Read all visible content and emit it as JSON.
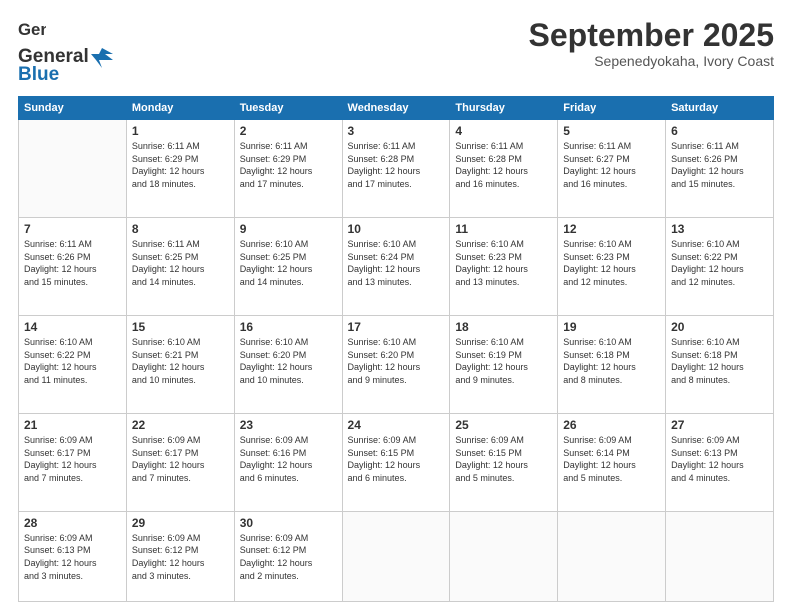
{
  "header": {
    "logo_line1": "General",
    "logo_line2": "Blue",
    "month": "September 2025",
    "location": "Sepenedyokaha, Ivory Coast"
  },
  "days_of_week": [
    "Sunday",
    "Monday",
    "Tuesday",
    "Wednesday",
    "Thursday",
    "Friday",
    "Saturday"
  ],
  "weeks": [
    [
      {
        "day": "",
        "info": ""
      },
      {
        "day": "1",
        "info": "Sunrise: 6:11 AM\nSunset: 6:29 PM\nDaylight: 12 hours\nand 18 minutes."
      },
      {
        "day": "2",
        "info": "Sunrise: 6:11 AM\nSunset: 6:29 PM\nDaylight: 12 hours\nand 17 minutes."
      },
      {
        "day": "3",
        "info": "Sunrise: 6:11 AM\nSunset: 6:28 PM\nDaylight: 12 hours\nand 17 minutes."
      },
      {
        "day": "4",
        "info": "Sunrise: 6:11 AM\nSunset: 6:28 PM\nDaylight: 12 hours\nand 16 minutes."
      },
      {
        "day": "5",
        "info": "Sunrise: 6:11 AM\nSunset: 6:27 PM\nDaylight: 12 hours\nand 16 minutes."
      },
      {
        "day": "6",
        "info": "Sunrise: 6:11 AM\nSunset: 6:26 PM\nDaylight: 12 hours\nand 15 minutes."
      }
    ],
    [
      {
        "day": "7",
        "info": "Sunrise: 6:11 AM\nSunset: 6:26 PM\nDaylight: 12 hours\nand 15 minutes."
      },
      {
        "day": "8",
        "info": "Sunrise: 6:11 AM\nSunset: 6:25 PM\nDaylight: 12 hours\nand 14 minutes."
      },
      {
        "day": "9",
        "info": "Sunrise: 6:10 AM\nSunset: 6:25 PM\nDaylight: 12 hours\nand 14 minutes."
      },
      {
        "day": "10",
        "info": "Sunrise: 6:10 AM\nSunset: 6:24 PM\nDaylight: 12 hours\nand 13 minutes."
      },
      {
        "day": "11",
        "info": "Sunrise: 6:10 AM\nSunset: 6:23 PM\nDaylight: 12 hours\nand 13 minutes."
      },
      {
        "day": "12",
        "info": "Sunrise: 6:10 AM\nSunset: 6:23 PM\nDaylight: 12 hours\nand 12 minutes."
      },
      {
        "day": "13",
        "info": "Sunrise: 6:10 AM\nSunset: 6:22 PM\nDaylight: 12 hours\nand 12 minutes."
      }
    ],
    [
      {
        "day": "14",
        "info": "Sunrise: 6:10 AM\nSunset: 6:22 PM\nDaylight: 12 hours\nand 11 minutes."
      },
      {
        "day": "15",
        "info": "Sunrise: 6:10 AM\nSunset: 6:21 PM\nDaylight: 12 hours\nand 10 minutes."
      },
      {
        "day": "16",
        "info": "Sunrise: 6:10 AM\nSunset: 6:20 PM\nDaylight: 12 hours\nand 10 minutes."
      },
      {
        "day": "17",
        "info": "Sunrise: 6:10 AM\nSunset: 6:20 PM\nDaylight: 12 hours\nand 9 minutes."
      },
      {
        "day": "18",
        "info": "Sunrise: 6:10 AM\nSunset: 6:19 PM\nDaylight: 12 hours\nand 9 minutes."
      },
      {
        "day": "19",
        "info": "Sunrise: 6:10 AM\nSunset: 6:18 PM\nDaylight: 12 hours\nand 8 minutes."
      },
      {
        "day": "20",
        "info": "Sunrise: 6:10 AM\nSunset: 6:18 PM\nDaylight: 12 hours\nand 8 minutes."
      }
    ],
    [
      {
        "day": "21",
        "info": "Sunrise: 6:09 AM\nSunset: 6:17 PM\nDaylight: 12 hours\nand 7 minutes."
      },
      {
        "day": "22",
        "info": "Sunrise: 6:09 AM\nSunset: 6:17 PM\nDaylight: 12 hours\nand 7 minutes."
      },
      {
        "day": "23",
        "info": "Sunrise: 6:09 AM\nSunset: 6:16 PM\nDaylight: 12 hours\nand 6 minutes."
      },
      {
        "day": "24",
        "info": "Sunrise: 6:09 AM\nSunset: 6:15 PM\nDaylight: 12 hours\nand 6 minutes."
      },
      {
        "day": "25",
        "info": "Sunrise: 6:09 AM\nSunset: 6:15 PM\nDaylight: 12 hours\nand 5 minutes."
      },
      {
        "day": "26",
        "info": "Sunrise: 6:09 AM\nSunset: 6:14 PM\nDaylight: 12 hours\nand 5 minutes."
      },
      {
        "day": "27",
        "info": "Sunrise: 6:09 AM\nSunset: 6:13 PM\nDaylight: 12 hours\nand 4 minutes."
      }
    ],
    [
      {
        "day": "28",
        "info": "Sunrise: 6:09 AM\nSunset: 6:13 PM\nDaylight: 12 hours\nand 3 minutes."
      },
      {
        "day": "29",
        "info": "Sunrise: 6:09 AM\nSunset: 6:12 PM\nDaylight: 12 hours\nand 3 minutes."
      },
      {
        "day": "30",
        "info": "Sunrise: 6:09 AM\nSunset: 6:12 PM\nDaylight: 12 hours\nand 2 minutes."
      },
      {
        "day": "",
        "info": ""
      },
      {
        "day": "",
        "info": ""
      },
      {
        "day": "",
        "info": ""
      },
      {
        "day": "",
        "info": ""
      }
    ]
  ]
}
